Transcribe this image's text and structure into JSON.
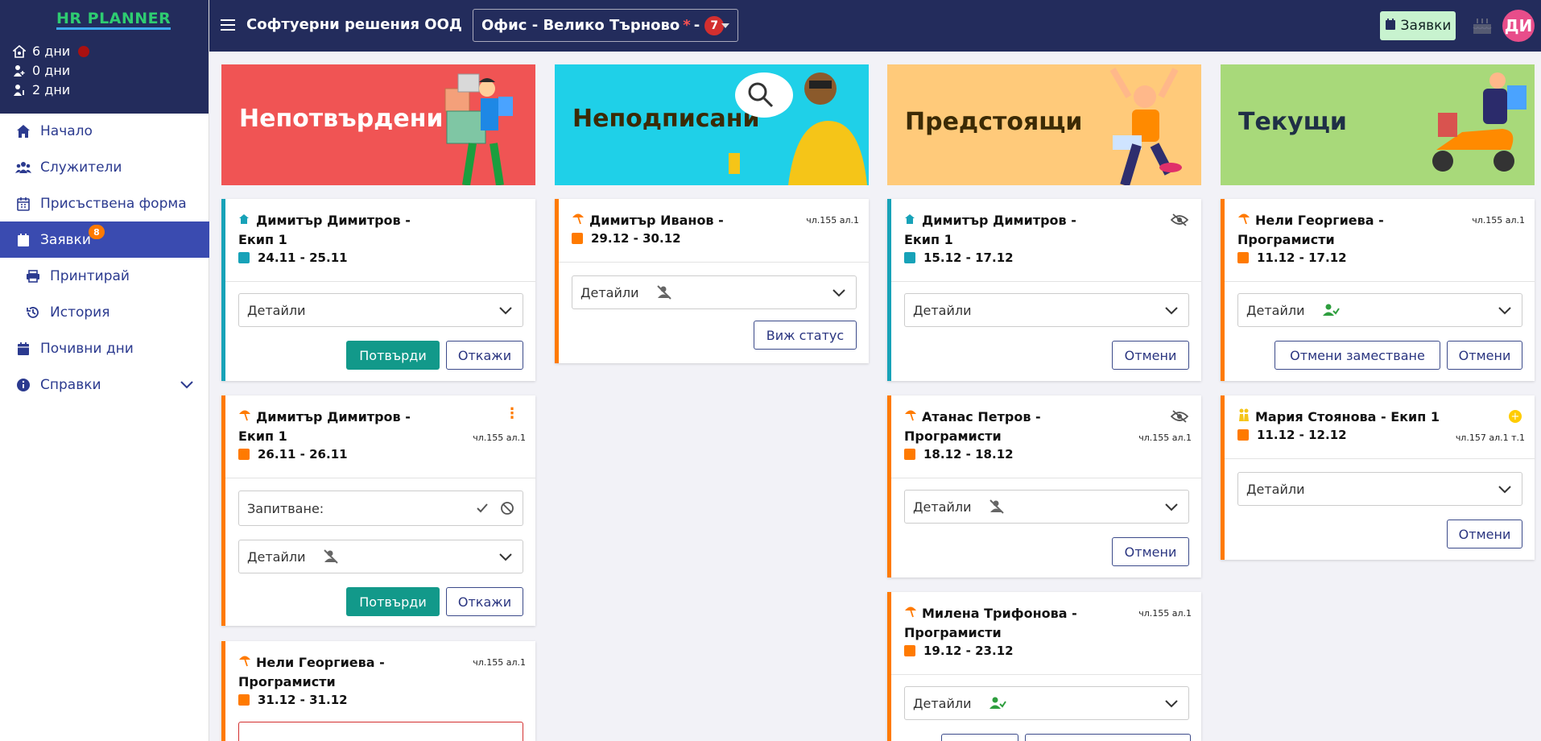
{
  "app": {
    "logo": "HR PLANNER"
  },
  "sidebar": {
    "stats": [
      {
        "icon": "home-user-icon",
        "value": "6 дни"
      },
      {
        "icon": "person-plus-icon",
        "value": "0 дни"
      },
      {
        "icon": "person-info-icon",
        "value": "2 дни"
      }
    ],
    "nav": [
      {
        "label": "Начало",
        "icon": "home-icon"
      },
      {
        "label": "Служители",
        "icon": "users-icon"
      },
      {
        "label": "Присъствена форма",
        "icon": "calendar-grid-icon"
      },
      {
        "label": "Заявки",
        "icon": "calendar-icon",
        "badge": "8"
      },
      {
        "label": "Принтирай",
        "icon": "printer-icon"
      },
      {
        "label": "История",
        "icon": "history-icon"
      },
      {
        "label": "Почивни дни",
        "icon": "calendar-icon"
      },
      {
        "label": "Справки",
        "icon": "info-icon"
      }
    ]
  },
  "topbar": {
    "company": "Софтуерни решения ООД",
    "office": "Офис - Велико Търново",
    "office_suffix": "-",
    "office_count": "7",
    "requests_label": "Заявки",
    "avatar_initials": "ДИ"
  },
  "columns": [
    {
      "title": "Непотвърдени",
      "bg": "#f05454"
    },
    {
      "title": "Неподписани",
      "bg": "#1fd0e8"
    },
    {
      "title": "Предстоящи",
      "bg": "#ffca7a"
    },
    {
      "title": "Текущи",
      "bg": "#a8d97a"
    }
  ],
  "cards": {
    "c1a": {
      "name1": "Димитър Димитров -",
      "name2": "Екип 1",
      "dates": "24.11 - 25.11",
      "details": "Детайли",
      "confirm": "Потвърди",
      "cancel": "Откажи"
    },
    "c1b": {
      "name1": "Димитър Димитров -",
      "name2": "Екип 1",
      "article": "чл.155 ал.1",
      "dates": "26.11 - 26.11",
      "question": "Запитване:",
      "details": "Детайли",
      "confirm": "Потвърди",
      "cancel": "Откажи"
    },
    "c1c": {
      "name1": "Нели Георгиева -",
      "name2": "Програмисти",
      "article": "чл.155 ал.1",
      "dates": "31.12 - 31.12"
    },
    "c2a": {
      "name1": "Димитър Иванов -",
      "article": "чл.155 ал.1",
      "dates": "29.12 - 30.12",
      "details": "Детайли",
      "status": "Виж статус"
    },
    "c3a": {
      "name1": "Димитър Димитров -",
      "name2": "Екип 1",
      "dates": "15.12 - 17.12",
      "details": "Детайли",
      "cancel": "Отмени"
    },
    "c3b": {
      "name1": "Атанас Петров -",
      "name2": "Програмисти",
      "article": "чл.155 ал.1",
      "dates": "18.12 - 18.12",
      "details": "Детайли",
      "cancel": "Отмени"
    },
    "c3c": {
      "name1": "Милена Трифонова -",
      "name2": "Програмисти",
      "article": "чл.155 ал.1",
      "dates": "19.12 - 23.12",
      "details": "Детайли"
    },
    "c4a": {
      "name1": "Нели Георгиева -",
      "name2": "Програмисти",
      "article": "чл.155 ал.1",
      "dates": "11.12 - 17.12",
      "details": "Детайли",
      "cancel_sub": "Отмени заместване",
      "cancel": "Отмени"
    },
    "c4b": {
      "name1": "Мария Стоянова - Екип 1",
      "article": "чл.157 ал.1 т.1",
      "dates": "11.12 - 12.12",
      "details": "Детайли",
      "cancel": "Отмени"
    }
  }
}
